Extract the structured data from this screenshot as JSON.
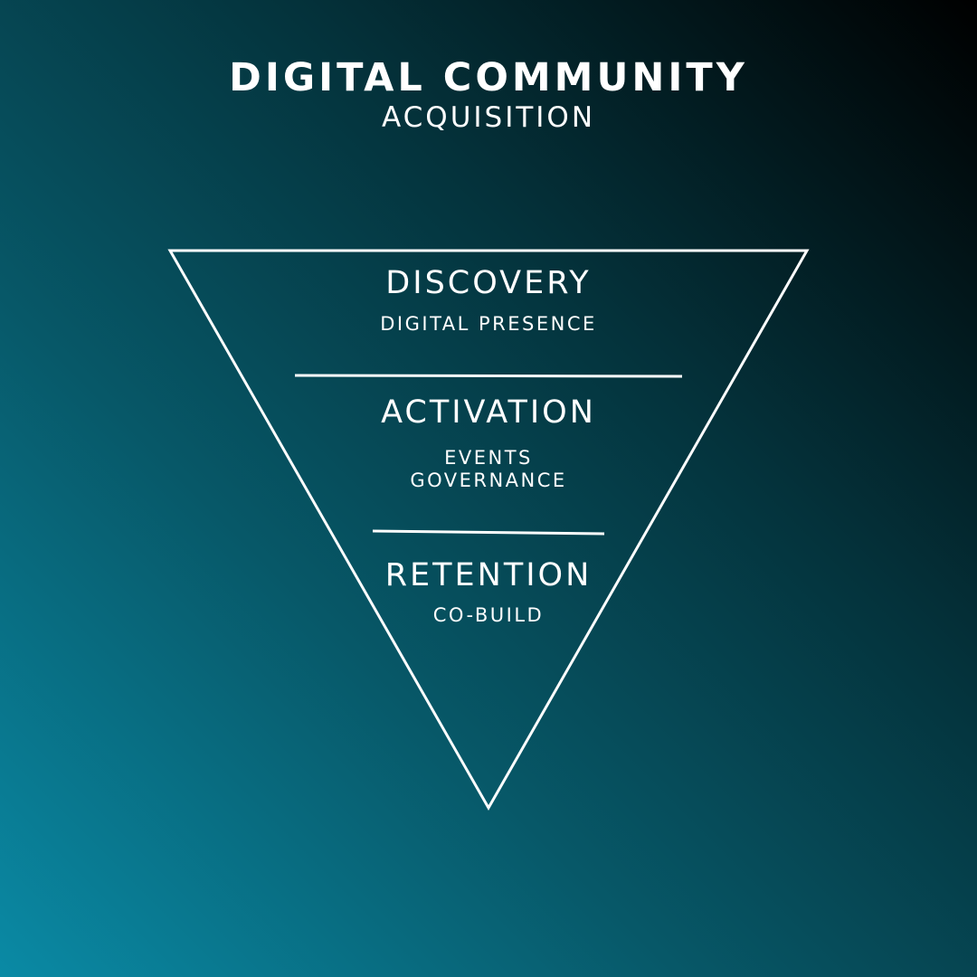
{
  "header": {
    "title": "DIGITAL COMMUNITY",
    "subtitle": "ACQUISITION"
  },
  "funnel": {
    "stages": [
      {
        "title": "DISCOVERY",
        "items": [
          "DIGITAL PRESENCE"
        ]
      },
      {
        "title": "ACTIVATION",
        "items": [
          "EVENTS",
          "GOVERNANCE"
        ]
      },
      {
        "title": "RETENTION",
        "items": [
          "CO-BUILD"
        ]
      }
    ]
  },
  "colors": {
    "text": "#ffffff",
    "line": "#ffffff",
    "background_light": "#0a8aa5",
    "background_dark": "#000000"
  }
}
